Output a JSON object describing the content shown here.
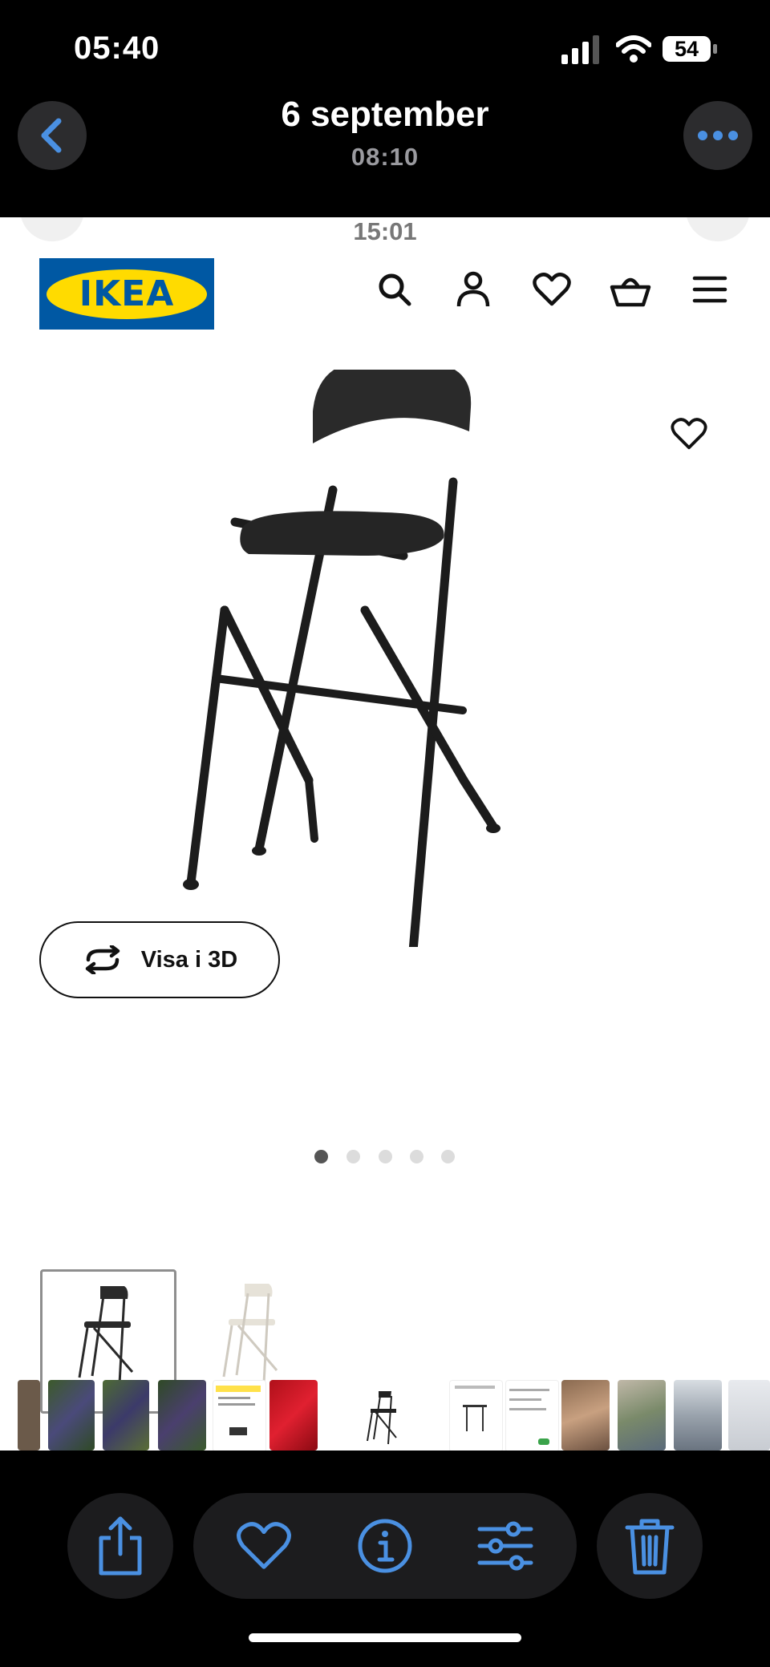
{
  "status_bar": {
    "time": "05:40",
    "battery": "54"
  },
  "nav": {
    "title": "6 september",
    "subtitle": "08:10"
  },
  "photo": {
    "peek_time": "15:01",
    "site": {
      "logo_text": "IKEA"
    },
    "header_icons": [
      "search-icon",
      "account-icon",
      "heart-icon",
      "basket-icon",
      "menu-icon"
    ],
    "view_3d_label": "Visa i 3D",
    "carousel": {
      "count": 5,
      "active": 1
    }
  },
  "filmstrip": {
    "items": 16
  },
  "toolbar": {
    "buttons": [
      "share-icon",
      "heart-icon",
      "info-icon",
      "adjust-icon",
      "trash-icon"
    ]
  },
  "colors": {
    "accent": "#4a90e2",
    "ikea_blue": "#0058a3",
    "ikea_yellow": "#ffdb00"
  }
}
